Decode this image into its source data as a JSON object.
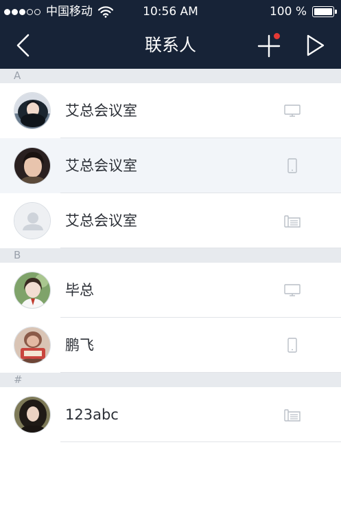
{
  "status_bar": {
    "carrier": "中国移动",
    "time": "10:56 AM",
    "battery": "100 %",
    "battery_level": 1.0,
    "signal_strength": 3,
    "signal_max": 5,
    "icons": [
      "signal-dots-icon",
      "wifi-icon",
      "battery-icon"
    ]
  },
  "nav": {
    "title": "联系人",
    "back_icon": "chevron-left-icon",
    "add_icon": "plus-icon",
    "send_icon": "play-triangle-icon",
    "badge_color": "#e53935"
  },
  "colors": {
    "nav_background": "#172337",
    "section_background": "#e7eaee",
    "highlight_row": "#f2f5f9",
    "device_icon": "#b8bec6"
  },
  "sections": [
    {
      "letter": "A",
      "contacts": [
        {
          "name": "艾总会议室",
          "avatar": "photo-avatar",
          "device": "desktop-monitor-icon",
          "highlighted": false
        },
        {
          "name": "艾总会议室",
          "avatar": "photo-avatar",
          "device": "mobile-phone-icon",
          "highlighted": true
        },
        {
          "name": "艾总会议室",
          "avatar": "default-person-avatar",
          "device": "desk-phone-icon",
          "highlighted": false
        }
      ]
    },
    {
      "letter": "B",
      "contacts": [
        {
          "name": "毕总",
          "avatar": "photo-avatar",
          "device": "desktop-monitor-icon",
          "highlighted": false
        },
        {
          "name": "鹏飞",
          "avatar": "photo-avatar",
          "device": "mobile-phone-icon",
          "highlighted": false
        }
      ]
    },
    {
      "letter": "#",
      "contacts": [
        {
          "name": "123abc",
          "avatar": "photo-avatar",
          "device": "desk-phone-icon",
          "highlighted": false
        }
      ]
    }
  ]
}
